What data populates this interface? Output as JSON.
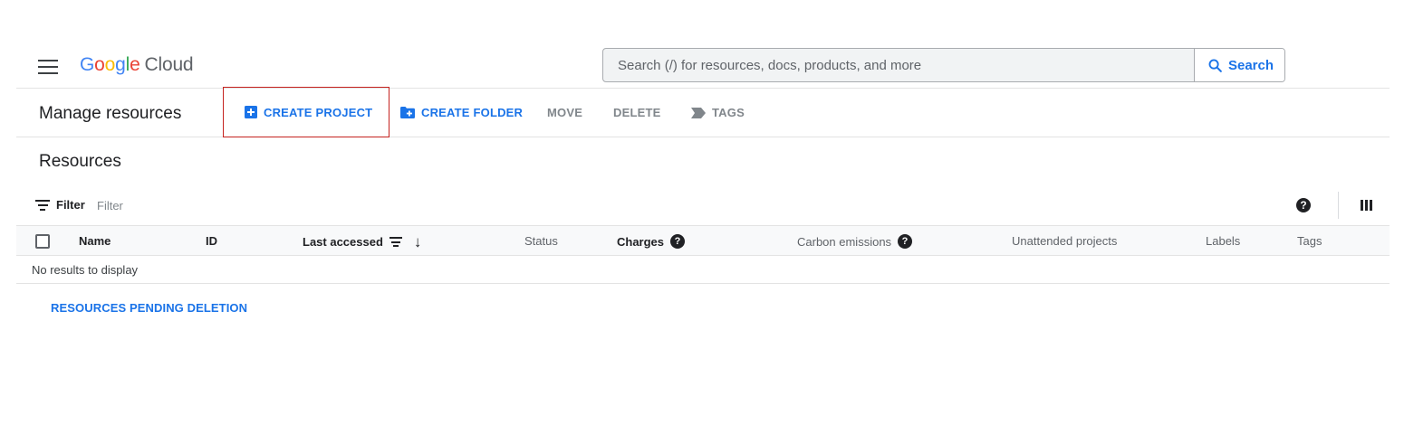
{
  "header": {
    "logo": {
      "letters": [
        "G",
        "o",
        "o",
        "g",
        "l",
        "e"
      ],
      "product": "Cloud"
    },
    "search": {
      "placeholder": "Search (/) for resources, docs, products, and more",
      "button_label": "Search"
    }
  },
  "toolbar": {
    "page_title": "Manage resources",
    "create_project": "CREATE PROJECT",
    "create_folder": "CREATE FOLDER",
    "move": "MOVE",
    "delete": "DELETE",
    "tags": "TAGS"
  },
  "resources": {
    "title": "Resources",
    "filter": {
      "label": "Filter",
      "placeholder": "Filter"
    },
    "help_glyph": "?",
    "columns": {
      "name": "Name",
      "id": "ID",
      "last_accessed": "Last accessed",
      "status": "Status",
      "charges": "Charges",
      "carbon_emissions": "Carbon emissions",
      "unattended_projects": "Unattended projects",
      "labels": "Labels",
      "tags": "Tags"
    },
    "empty_message": "No results to display",
    "pending_deletion_link": "RESOURCES PENDING DELETION"
  },
  "colors": {
    "accent_blue": "#1a73e8",
    "highlight_border": "#c5221f",
    "logo_blue": "#4285f4",
    "logo_red": "#ea4335",
    "logo_yellow": "#fbbc04",
    "logo_green": "#34a853"
  },
  "icons": [
    "menu-icon",
    "search-icon",
    "add-box-icon",
    "create-new-folder-icon",
    "label-icon",
    "filter-icon",
    "help-icon",
    "column-display-icon",
    "sort-icon",
    "arrow-down-icon"
  ]
}
